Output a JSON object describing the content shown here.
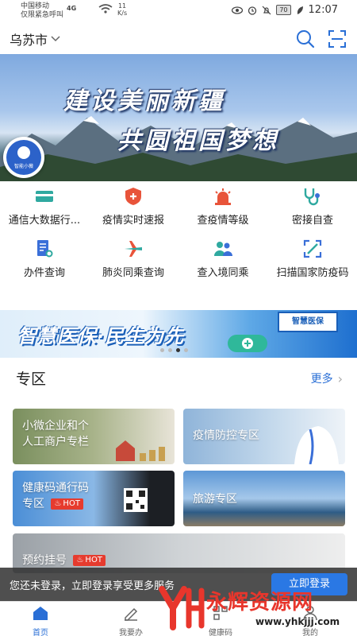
{
  "status_bar": {
    "carrier": "中国移动",
    "carrier_sub": "仅限紧急呼叫",
    "network": "4G",
    "speed_value": "11",
    "speed_unit": "K/s",
    "battery": "70",
    "time": "12:07"
  },
  "header": {
    "city": "乌苏市",
    "search_icon": "search-icon",
    "scan_icon": "scan-icon"
  },
  "banner": {
    "line1": "建设美丽新疆",
    "line2": "共圆祖国梦想",
    "assistant_label": "智能小薇"
  },
  "services": [
    {
      "label": "通信大数据行...",
      "icon": "card-icon",
      "color": "#2fa9a0"
    },
    {
      "label": "疫情实时速报",
      "icon": "shield-plus-icon",
      "color": "#e8543a"
    },
    {
      "label": "查疫情等级",
      "icon": "alarm-light-icon",
      "color": "#e8543a"
    },
    {
      "label": "密接自查",
      "icon": "stethoscope-icon",
      "color": "#2fa9a0"
    },
    {
      "label": "办件查询",
      "icon": "document-search-icon",
      "color": "#3a6fd8"
    },
    {
      "label": "肺炎同乘查询",
      "icon": "airplane-icon",
      "color": "#2fa9a0"
    },
    {
      "label": "查入境同乘",
      "icon": "people-icon",
      "color": "#2fa9a0"
    },
    {
      "label": "扫描国家防疫码",
      "icon": "scan-code-icon",
      "color": "#3a6fd8"
    }
  ],
  "promo": {
    "text": "智慧医保·民生为先",
    "sign": "智慧医保"
  },
  "zone": {
    "title": "专区",
    "more": "更多",
    "cards": [
      {
        "line1": "小微企业和个",
        "line2": "人工商户专栏"
      },
      {
        "line1": "疫情防控专区"
      },
      {
        "line1": "健康码通行码",
        "line2": "专区",
        "hot": "HOT"
      },
      {
        "line1": "旅游专区"
      },
      {
        "line1": "预约挂号",
        "hot": "HOT"
      }
    ]
  },
  "login": {
    "text": "您还未登录，立即登录享受更多服务",
    "button": "立即登录"
  },
  "nav": [
    {
      "label": "首页",
      "icon": "home-icon",
      "active": true
    },
    {
      "label": "我要办",
      "icon": "pen-icon",
      "active": false
    },
    {
      "label": "健康码",
      "icon": "qr-icon",
      "active": false
    },
    {
      "label": "我的",
      "icon": "user-icon",
      "active": false
    }
  ],
  "watermark": {
    "text": "永辉资源网",
    "url": "www.yhkjjj.com"
  }
}
